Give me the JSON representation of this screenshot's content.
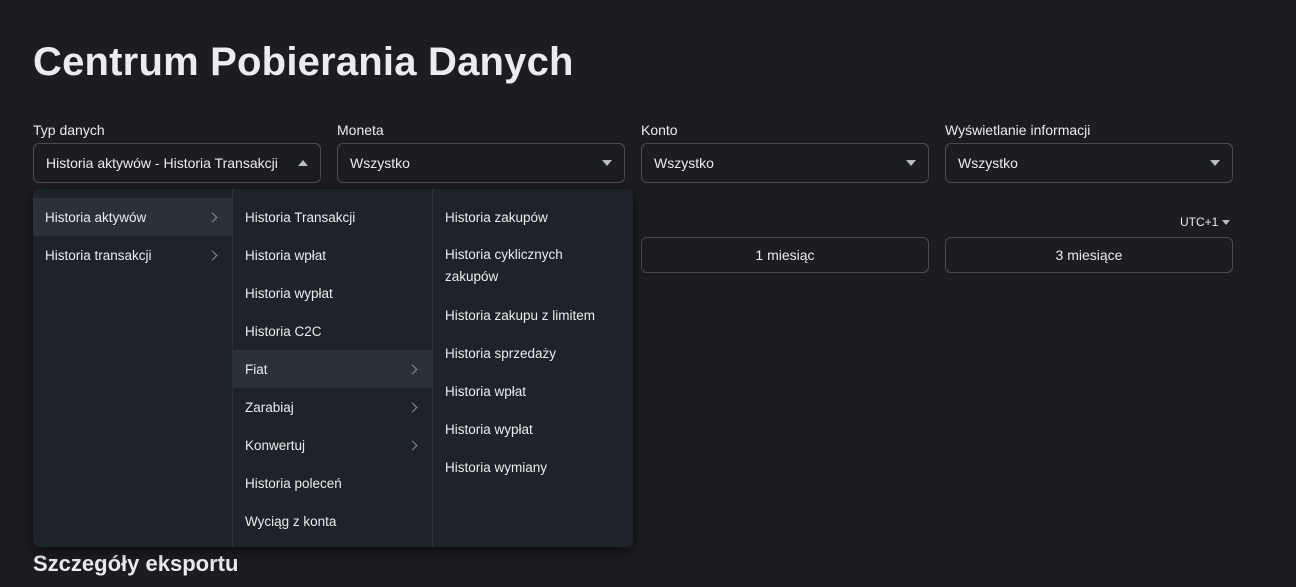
{
  "page_title": "Centrum Pobierania Danych",
  "filters": {
    "data_type": {
      "label": "Typ danych",
      "value": "Historia aktywów - Historia Transakcji"
    },
    "coin": {
      "label": "Moneta",
      "value": "Wszystko"
    },
    "account": {
      "label": "Konto",
      "value": "Wszystko"
    },
    "display": {
      "label": "Wyświetlanie informacji",
      "value": "Wszystko"
    }
  },
  "timezone": "UTC+1",
  "periods": [
    "1 miesiąc",
    "3 miesiące"
  ],
  "section_title": "Szczegóły eksportu",
  "menu": {
    "col1": [
      "Historia aktywów",
      "Historia transakcji"
    ],
    "col2": [
      "Historia Transakcji",
      "Historia wpłat",
      "Historia wypłat",
      "Historia C2C",
      "Fiat",
      "Zarabiaj",
      "Konwertuj",
      "Historia poleceń",
      "Wyciąg z konta"
    ],
    "col3": [
      "Historia zakupów",
      "Historia cyklicznych zakupów",
      "Historia zakupu z limitem",
      "Historia sprzedaży",
      "Historia wpłat",
      "Historia wypłat",
      "Historia wymiany"
    ]
  },
  "icons": {
    "caret": "caret-icon",
    "chevron": "chevron-right-icon"
  }
}
